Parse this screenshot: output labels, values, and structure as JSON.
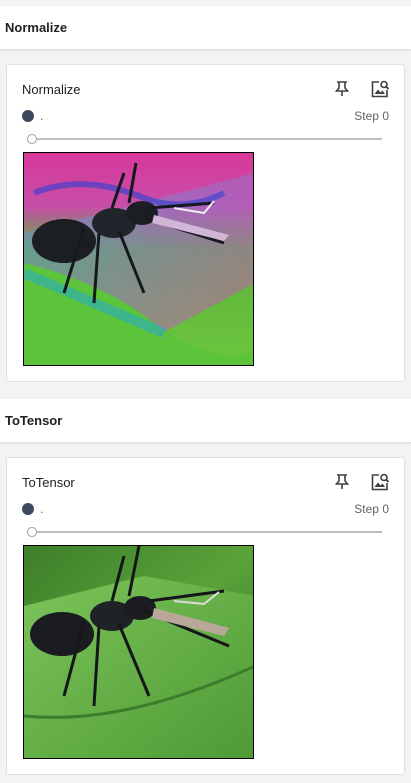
{
  "sections": [
    {
      "header": "Normalize",
      "card": {
        "title": "Normalize",
        "run_name": ".",
        "run_color": "#3c4a5f",
        "step_label": "Step 0",
        "step_value": 0,
        "image_variant": "normalized"
      }
    },
    {
      "header": "ToTensor",
      "card": {
        "title": "ToTensor",
        "run_name": ".",
        "run_color": "#3c4a5f",
        "step_label": "Step 0",
        "step_value": 0,
        "image_variant": "original"
      }
    }
  ],
  "icons": {
    "pin": "pin-icon",
    "inspect": "image-search-icon"
  }
}
